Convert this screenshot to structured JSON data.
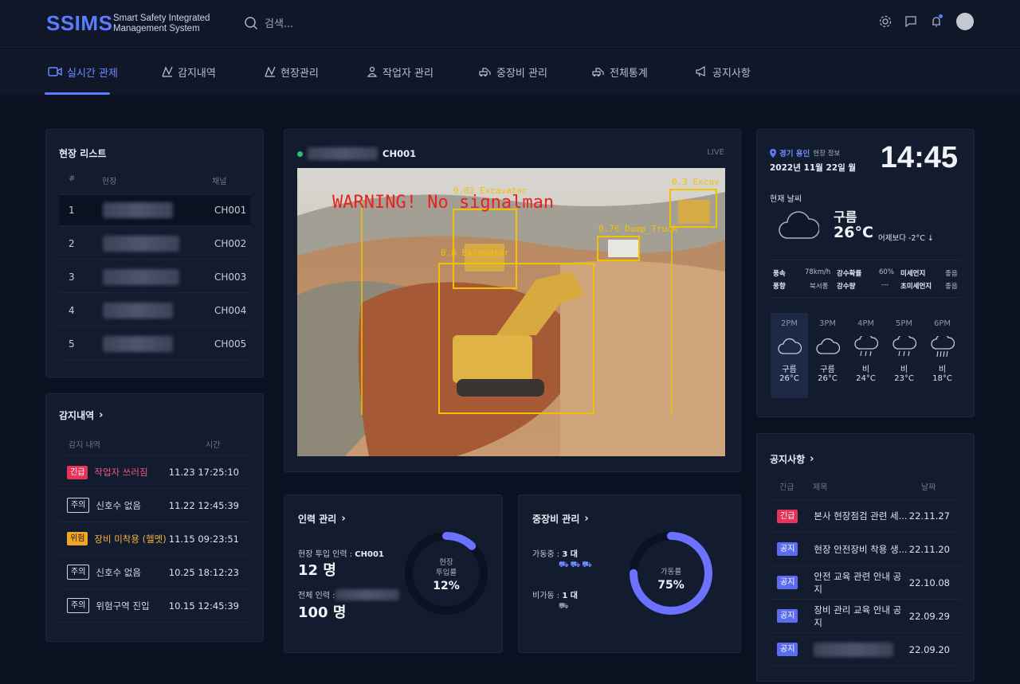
{
  "header": {
    "logo": "SSIMS",
    "logo_sub_1": "Smart Safety Integrated",
    "logo_sub_2": "Management System",
    "search_placeholder": "검색..."
  },
  "nav": {
    "items": [
      {
        "label": "실시간 관제",
        "icon": "camera-icon"
      },
      {
        "label": "감지내역",
        "icon": "chart-icon"
      },
      {
        "label": "현장관리",
        "icon": "chart-icon"
      },
      {
        "label": "작업자 관리",
        "icon": "worker-icon"
      },
      {
        "label": "중장비 관리",
        "icon": "excavator-icon"
      },
      {
        "label": "전체통계",
        "icon": "stats-icon"
      },
      {
        "label": "공지사항",
        "icon": "megaphone-icon"
      }
    ]
  },
  "site_list": {
    "title": "현장 리스트",
    "headers": [
      "#",
      "현장",
      "채널"
    ],
    "rows": [
      {
        "num": "1",
        "channel": "CH001"
      },
      {
        "num": "2",
        "channel": "CH002"
      },
      {
        "num": "3",
        "channel": "CH003"
      },
      {
        "num": "4",
        "channel": "CH004"
      },
      {
        "num": "5",
        "channel": "CH005"
      }
    ]
  },
  "detections": {
    "title": "감지내역",
    "headers": [
      "감지 내역",
      "시간"
    ],
    "rows": [
      {
        "badge": "긴급",
        "badge_color": "#e5335a",
        "text": "작업자 쓰러짐",
        "text_color": "#f0587d",
        "time": "11.23 17:25:10"
      },
      {
        "badge": "주의",
        "badge_color": "outline",
        "text": "신호수 없음",
        "text_color": "#d3d8e4",
        "time": "11.22 12:45:39"
      },
      {
        "badge": "위험",
        "badge_color": "#f5a524",
        "text": "장비 미착용 (헬멧)",
        "text_color": "#f5b33c",
        "time": "11.15 09:23:51"
      },
      {
        "badge": "주의",
        "badge_color": "outline",
        "text": "신호수 없음",
        "text_color": "#d3d8e4",
        "time": "10.25 18:12:23"
      },
      {
        "badge": "주의",
        "badge_color": "outline",
        "text": "위험구역 진입",
        "text_color": "#d3d8e4",
        "time": "10.15 12:45:39"
      }
    ]
  },
  "video": {
    "channel": "CH001",
    "live": "LIVE",
    "warning": "WARNING! No signalman",
    "boxes": [
      "0.82 Excavator",
      "0.8 Excavator",
      "0.76 Dump_Truck",
      "0.3 Excav"
    ]
  },
  "workforce": {
    "title": "인력 관리",
    "label1": "현장 투입 인력 : ",
    "channel": "CH001",
    "value1": "12 명",
    "label2": "전체 인력 : ",
    "value2": "100 명",
    "gauge_label_1": "현장",
    "gauge_label_2": "투입률",
    "gauge_value": "12%",
    "percent": 12
  },
  "equipment": {
    "title": "중장비 관리",
    "active_label": "가동중 : ",
    "active_value": "3 대",
    "idle_label": "비가동 : ",
    "idle_value": "1 대",
    "gauge_label": "가동률",
    "gauge_value": "75%",
    "percent": 75
  },
  "weather": {
    "location": "경기 용인",
    "location_suffix": "현장 정보",
    "date": "2022년 11월 22일 월",
    "time": "14:45",
    "current_label": "현재 날씨",
    "condition": "구름",
    "temp": "26°C",
    "compare": "어제보다 -2°C ↓",
    "details": [
      {
        "k1": "풍속",
        "v1": "78km/h",
        "k2": "강수확률",
        "v2": "60%",
        "k3": "미세먼지",
        "v3": "좋음"
      },
      {
        "k1": "풍향",
        "v1": "북서풍",
        "k2": "강수량",
        "v2": "---",
        "k3": "초미세먼지",
        "v3": "좋음"
      }
    ],
    "hourly": [
      {
        "time": "2PM",
        "cond": "구름",
        "temp": "26°C",
        "icon": "cloud-icon"
      },
      {
        "time": "3PM",
        "cond": "구름",
        "temp": "26°C",
        "icon": "cloud-icon"
      },
      {
        "time": "4PM",
        "cond": "비",
        "temp": "24°C",
        "icon": "rain-icon"
      },
      {
        "time": "5PM",
        "cond": "비",
        "temp": "23°C",
        "icon": "rain-icon"
      },
      {
        "time": "6PM",
        "cond": "비",
        "temp": "18°C",
        "icon": "rain-icon"
      }
    ]
  },
  "notices": {
    "title": "공지사항",
    "headers": [
      "긴급",
      "제목",
      "날짜"
    ],
    "rows": [
      {
        "badge": "긴급",
        "badge_color": "#e5335a",
        "title": "본사 현장점검 관련 세...",
        "date": "22.11.27"
      },
      {
        "badge": "공지",
        "badge_color": "#5b6cf0",
        "title": "현장 안전장비 착용 생...",
        "date": "22.11.20"
      },
      {
        "badge": "공지",
        "badge_color": "#5b6cf0",
        "title": "안전 교육 관련 안내 공지",
        "date": "22.10.08"
      },
      {
        "badge": "공지",
        "badge_color": "#5b6cf0",
        "title": "장비 관리 교육 안내 공지",
        "date": "22.09.29"
      },
      {
        "badge": "공지",
        "badge_color": "#5b6cf0",
        "title": "",
        "date": "22.09.20"
      }
    ]
  }
}
